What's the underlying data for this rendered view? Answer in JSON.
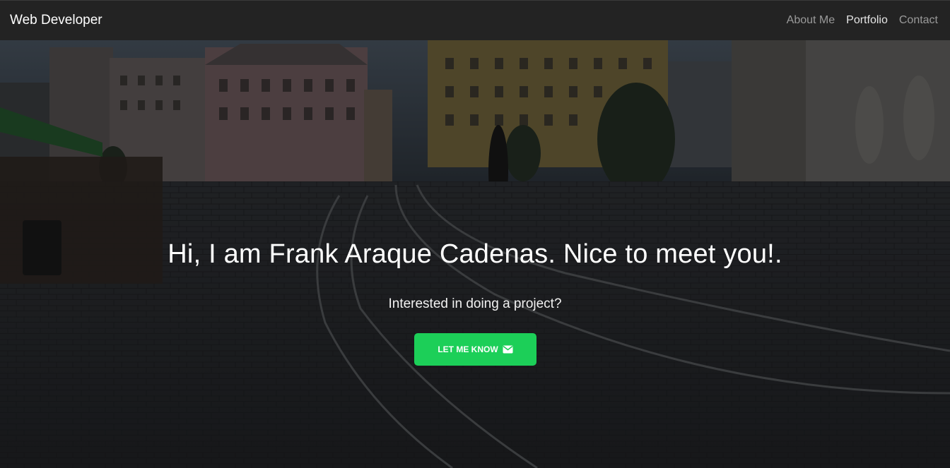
{
  "navbar": {
    "brand": "Web Developer",
    "links": [
      {
        "label": "About Me",
        "active": false
      },
      {
        "label": "Portfolio",
        "active": true
      },
      {
        "label": "Contact",
        "active": false
      }
    ]
  },
  "hero": {
    "title": "Hi, I am Frank Araque Cadenas. Nice to meet you!.",
    "subtitle": "Interested in doing a project?",
    "cta_label": "LET ME KNOW",
    "cta_icon": "envelope-icon",
    "cta_color": "#1ccf58",
    "background": "dark-overlay city square photo"
  },
  "colors": {
    "navbar_bg": "#232323",
    "brand_text": "#ffffff",
    "nav_inactive": "#9a9a9a",
    "nav_active": "#e6e6e6"
  }
}
